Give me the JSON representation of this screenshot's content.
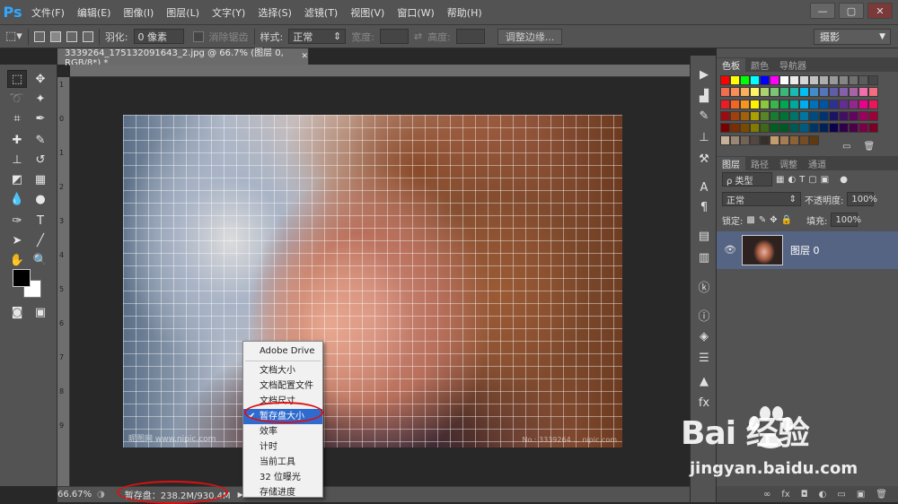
{
  "menubar": {
    "logo": "Ps",
    "items": [
      "文件(F)",
      "编辑(E)",
      "图像(I)",
      "图层(L)",
      "文字(Y)",
      "选择(S)",
      "滤镜(T)",
      "视图(V)",
      "窗口(W)",
      "帮助(H)"
    ],
    "window_controls": [
      "—",
      "▢",
      "✕"
    ]
  },
  "options": {
    "feather_label": "羽化:",
    "feather_value": "0 像素",
    "antialias_label": "消除锯齿",
    "style_label": "样式:",
    "style_value": "正常",
    "width_label": "宽度:",
    "height_label": "高度:",
    "refine_edge": "调整边缘...",
    "workspace": "摄影"
  },
  "document": {
    "tab_title": "3339264_175132091643_2.jpg @ 66.7% (图层 0, RGB/8*) *",
    "tab_close": "✕",
    "watermark_left": "昵图网 www.nipic.com",
    "watermark_right": "No.: 3339264 ... nipic.com",
    "ruler_left_marks": [
      "1",
      "0",
      "1",
      "2",
      "3",
      "4",
      "5",
      "6",
      "7",
      "8",
      "9"
    ]
  },
  "status": {
    "zoom": "66.67%",
    "scratch": "暂存盘：238.2M/930.4M",
    "arrow": "▶"
  },
  "popup_menu": {
    "items": [
      {
        "label": "Adobe Drive",
        "checked": false,
        "highlight": false
      },
      {
        "label": "文档大小",
        "checked": false,
        "highlight": false
      },
      {
        "label": "文档配置文件",
        "checked": false,
        "highlight": false
      },
      {
        "label": "文档尺寸",
        "checked": false,
        "highlight": false
      },
      {
        "label": "暂存盘大小",
        "checked": true,
        "highlight": true
      },
      {
        "label": "效率",
        "checked": false,
        "highlight": false
      },
      {
        "label": "计时",
        "checked": false,
        "highlight": false
      },
      {
        "label": "当前工具",
        "checked": false,
        "highlight": false
      },
      {
        "label": "32 位曝光",
        "checked": false,
        "highlight": false
      },
      {
        "label": "存储进度",
        "checked": false,
        "highlight": false
      }
    ],
    "check": "✔"
  },
  "color_panel": {
    "tabs": [
      "色板",
      "颜色",
      "导航器"
    ],
    "swatch_colors": [
      "#ff0000",
      "#ffff00",
      "#00ff00",
      "#00ffff",
      "#0000ff",
      "#ff00ff",
      "#ffffff",
      "#ebebeb",
      "#d6d6d6",
      "#c2c2c2",
      "#adadad",
      "#999999",
      "#858585",
      "#707070",
      "#5c5c5c",
      "#474747",
      "#f26c4f",
      "#f68e55",
      "#fbaf5c",
      "#fff467",
      "#acd372",
      "#7cc576",
      "#3bb878",
      "#1abbb4",
      "#00bff3",
      "#438ccb",
      "#5574b9",
      "#605ca8",
      "#855fa8",
      "#a763a8",
      "#f06ea9",
      "#f26d7d",
      "#ed1c24",
      "#f26522",
      "#f7941d",
      "#fff200",
      "#8dc73f",
      "#39b54a",
      "#00a651",
      "#00a99d",
      "#00aeef",
      "#0072bc",
      "#0054a6",
      "#2e3192",
      "#662d91",
      "#92278f",
      "#ec008c",
      "#ed145b",
      "#9e0b0f",
      "#a0410d",
      "#a36209",
      "#aba000",
      "#598527",
      "#197b30",
      "#007236",
      "#00746b",
      "#0076a3",
      "#004b80",
      "#003471",
      "#1b1464",
      "#440e62",
      "#630460",
      "#9e005d",
      "#9e0039",
      "#790000",
      "#7b2e00",
      "#7d4900",
      "#827b00",
      "#406618",
      "#005e20",
      "#005826",
      "#005952",
      "#005b7f",
      "#003663",
      "#002157",
      "#0d004c",
      "#32004b",
      "#4b0049",
      "#7b0046",
      "#7a0026",
      "#c7b299",
      "#998675",
      "#736357",
      "#534741",
      "#372f2c",
      "#c69c6d",
      "#a67c52",
      "#8c6239",
      "#754c24",
      "#603913"
    ]
  },
  "layers_panel": {
    "tabs": [
      "图层",
      "路径",
      "调整",
      "通道"
    ],
    "filter_value": "ρ 类型",
    "blend_mode": "正常",
    "opacity_label": "不透明度:",
    "opacity_value": "100%",
    "lock_label": "锁定:",
    "fill_label": "填充:",
    "fill_value": "100%",
    "layer_name": "图层 0",
    "bottom_icons": [
      "∞",
      "fx",
      "◘",
      "◐",
      "▭",
      "▣",
      "🗑"
    ]
  },
  "watermark_brand": {
    "logo": "Bai  经验",
    "url": "jingyan.baidu.com"
  }
}
